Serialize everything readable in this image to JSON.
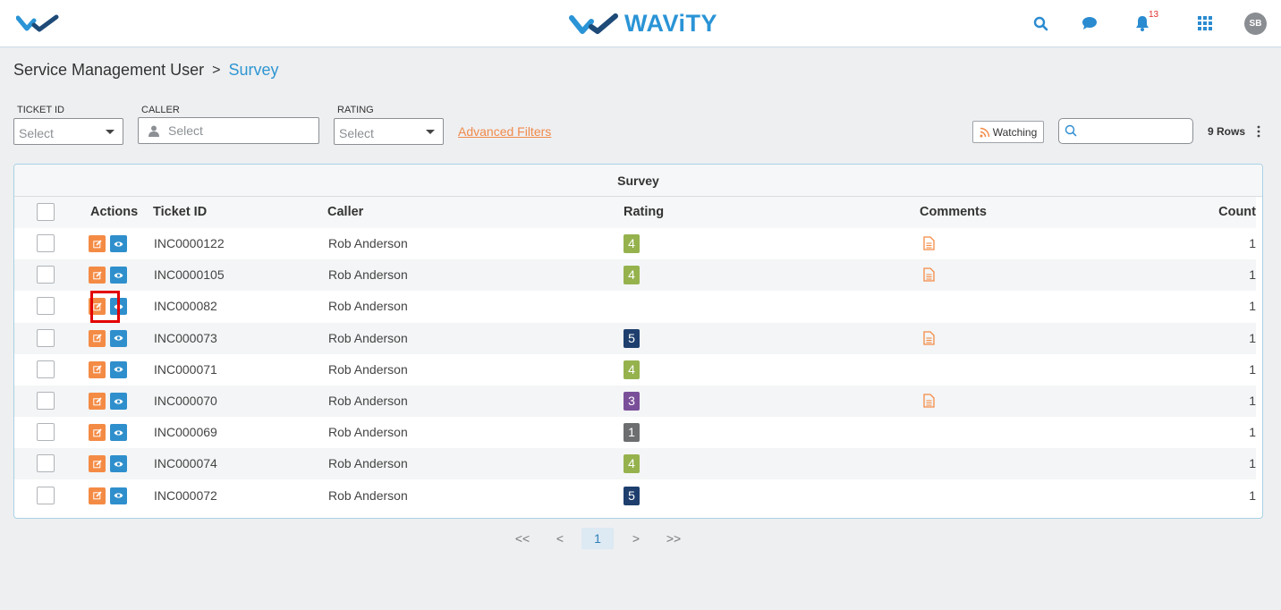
{
  "header": {
    "brand": "WAViTY",
    "notification_count": "13",
    "avatar_initials": "SB"
  },
  "breadcrumb": {
    "parent": "Service Management User",
    "separator": ">",
    "current": "Survey"
  },
  "filters": {
    "ticket_id": {
      "label": "TICKET ID",
      "placeholder": "Select"
    },
    "caller": {
      "label": "CALLER",
      "placeholder": "Select"
    },
    "rating": {
      "label": "RATING",
      "placeholder": "Select"
    },
    "advanced": "Advanced Filters"
  },
  "toolbar": {
    "watching": "Watching",
    "search_value": "",
    "rows_count": "9 Rows"
  },
  "table": {
    "title": "Survey",
    "columns": {
      "actions": "Actions",
      "ticket_id": "Ticket ID",
      "caller": "Caller",
      "rating": "Rating",
      "comments": "Comments",
      "count": "Count"
    },
    "rows": [
      {
        "ticket_id": "INC0000122",
        "caller": "Rob Anderson",
        "rating": "4",
        "has_comment": true,
        "count": "1"
      },
      {
        "ticket_id": "INC0000105",
        "caller": "Rob Anderson",
        "rating": "4",
        "has_comment": true,
        "count": "1"
      },
      {
        "ticket_id": "INC000082",
        "caller": "Rob Anderson",
        "rating": "",
        "has_comment": false,
        "count": "1"
      },
      {
        "ticket_id": "INC000073",
        "caller": "Rob Anderson",
        "rating": "5",
        "has_comment": true,
        "count": "1"
      },
      {
        "ticket_id": "INC000071",
        "caller": "Rob Anderson",
        "rating": "4",
        "has_comment": false,
        "count": "1"
      },
      {
        "ticket_id": "INC000070",
        "caller": "Rob Anderson",
        "rating": "3",
        "has_comment": true,
        "count": "1"
      },
      {
        "ticket_id": "INC000069",
        "caller": "Rob Anderson",
        "rating": "1",
        "has_comment": false,
        "count": "1"
      },
      {
        "ticket_id": "INC000074",
        "caller": "Rob Anderson",
        "rating": "4",
        "has_comment": false,
        "count": "1"
      },
      {
        "ticket_id": "INC000072",
        "caller": "Rob Anderson",
        "rating": "5",
        "has_comment": false,
        "count": "1"
      }
    ]
  },
  "rating_colors": {
    "1": "#6d6e70",
    "3": "#7a4f9a",
    "4": "#95b24d",
    "5": "#1e3f6e"
  },
  "colors": {
    "brand": "#2a94d6",
    "edit_button": "#f48b45",
    "view_button": "#2f8fcc",
    "comment_icon": "#f48b45",
    "highlight": "#e30000"
  },
  "pagination": {
    "first": "<<",
    "prev": "<",
    "current": "1",
    "next": ">",
    "last": ">>"
  }
}
